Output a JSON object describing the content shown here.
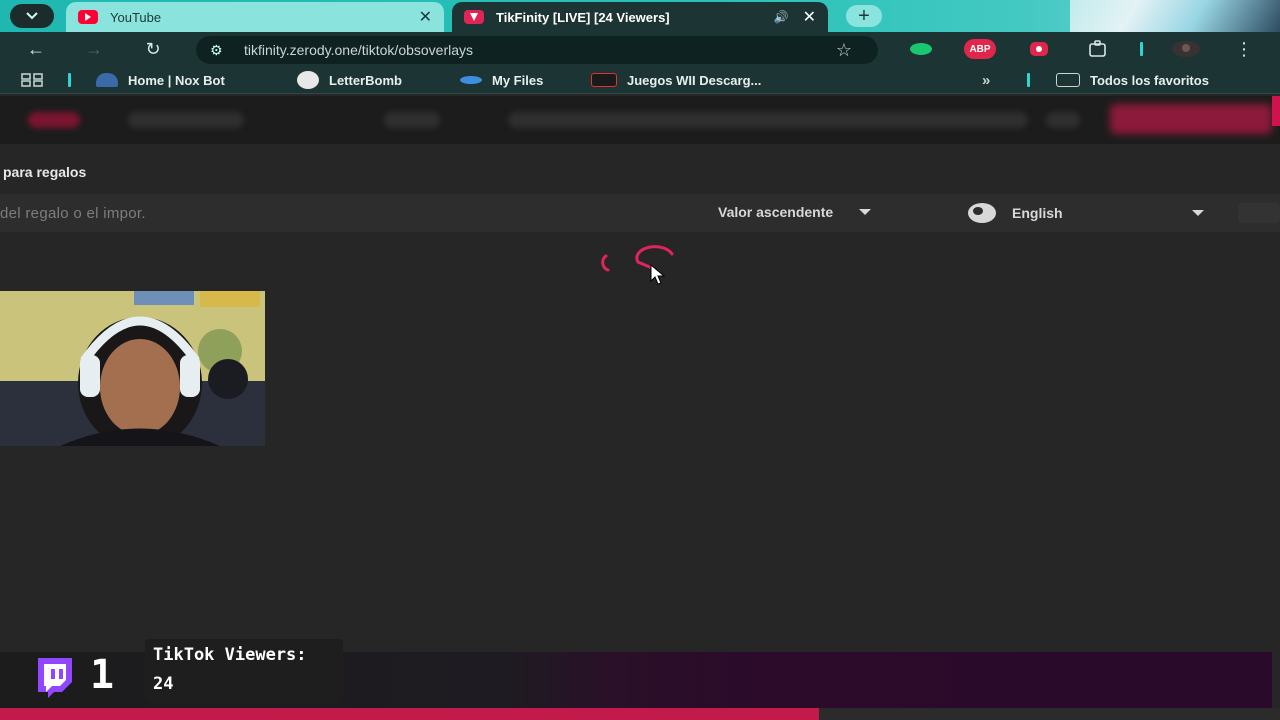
{
  "browser": {
    "tabs": [
      {
        "title": "YouTube",
        "favicon": "youtube-icon",
        "active": false
      },
      {
        "title": "TikFinity [LIVE] [24 Viewers]",
        "favicon": "tikfinity-icon",
        "active": true
      }
    ],
    "address": "tikfinity.zerody.one/tiktok/obsoverlays",
    "bookmarks": [
      {
        "label": "Home | Nox Bot",
        "icon": "nox-bot-icon"
      },
      {
        "label": "LetterBomb",
        "icon": "letterbomb-icon"
      },
      {
        "label": "My Files",
        "icon": "myfiles-icon"
      },
      {
        "label": "Juegos WII Descarg...",
        "icon": "gt-icon"
      }
    ],
    "bookmarks_more": "»",
    "all_bookmarks": "Todos los favoritos",
    "extensions": {
      "abp": "ABP"
    }
  },
  "page": {
    "section_title": "para regalos",
    "search_placeholder": "del regalo o el impor.",
    "sort_value": "Valor ascendente",
    "language_value": "English"
  },
  "overlay": {
    "twitch_count": "1",
    "viewers_label": "TikTok Viewers:",
    "viewers_value": "24",
    "progress_fraction": 0.64
  },
  "colors": {
    "accent": "#c21a4a",
    "chrome": "#1d3434",
    "tab_strip": "#27c2b8",
    "twitch": "#9146ff"
  }
}
